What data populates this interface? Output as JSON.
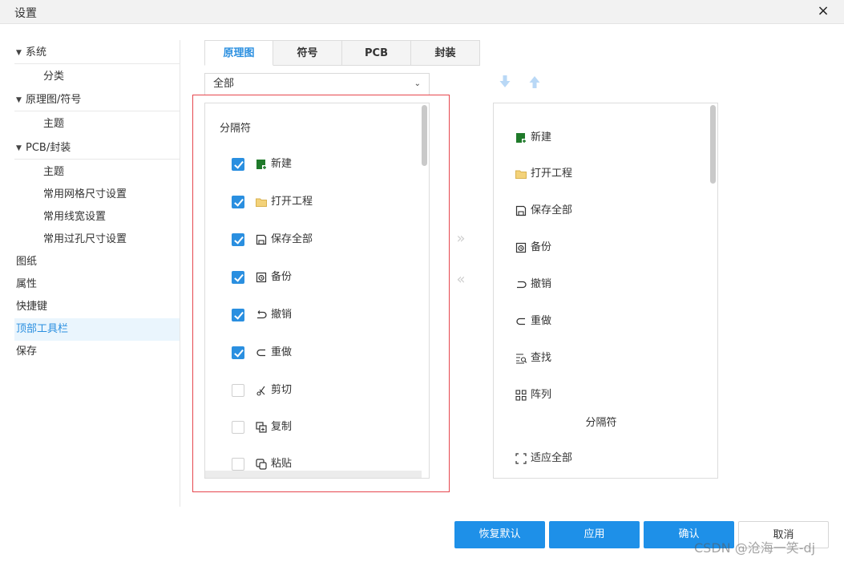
{
  "window": {
    "title": "设置",
    "close_glyph": "×"
  },
  "sidebar": {
    "groups": [
      {
        "label": "系统",
        "children": [
          "分类"
        ]
      },
      {
        "label": "原理图/符号",
        "children": [
          "主题"
        ]
      },
      {
        "label": "PCB/封装",
        "children": [
          "主题",
          "常用网格尺寸设置",
          "常用线宽设置",
          "常用过孔尺寸设置"
        ]
      }
    ],
    "items": [
      "图纸",
      "属性",
      "快捷键",
      "顶部工具栏",
      "保存"
    ],
    "active_item": "顶部工具栏"
  },
  "tabs": [
    {
      "label": "原理图",
      "active": true
    },
    {
      "label": "符号",
      "active": false
    },
    {
      "label": "PCB",
      "active": false
    },
    {
      "label": "封装",
      "active": false
    }
  ],
  "filter": {
    "value": "全部"
  },
  "available": {
    "separator_label": "分隔符",
    "items": [
      {
        "label": "新建",
        "checked": true,
        "icon": "new-file-icon"
      },
      {
        "label": "打开工程",
        "checked": true,
        "icon": "folder-icon"
      },
      {
        "label": "保存全部",
        "checked": true,
        "icon": "save-icon"
      },
      {
        "label": "备份",
        "checked": true,
        "icon": "backup-icon"
      },
      {
        "label": "撤销",
        "checked": true,
        "icon": "undo-icon"
      },
      {
        "label": "重做",
        "checked": true,
        "icon": "redo-icon"
      },
      {
        "label": "剪切",
        "checked": false,
        "icon": "scissors-icon"
      },
      {
        "label": "复制",
        "checked": false,
        "icon": "copy-icon"
      },
      {
        "label": "粘贴",
        "checked": false,
        "icon": "paste-icon"
      }
    ]
  },
  "move_buttons": {
    "add": "»",
    "remove": "«"
  },
  "selected": {
    "items": [
      {
        "label": "新建",
        "icon": "new-file-icon"
      },
      {
        "label": "打开工程",
        "icon": "folder-icon"
      },
      {
        "label": "保存全部",
        "icon": "save-icon"
      },
      {
        "label": "备份",
        "icon": "backup-icon"
      },
      {
        "label": "撤销",
        "icon": "undo-icon"
      },
      {
        "label": "重做",
        "icon": "redo-icon"
      },
      {
        "label": "查找",
        "icon": "find-icon"
      },
      {
        "label": "阵列",
        "icon": "array-icon"
      },
      {
        "label": "分隔符",
        "icon": "",
        "separator": true
      },
      {
        "label": "适应全部",
        "icon": "fit-all-icon"
      }
    ]
  },
  "footer": {
    "restore_label": "恢复默认",
    "apply_label": "应用",
    "confirm_label": "确认",
    "cancel_label": "取消"
  },
  "watermark": "CSDN @沧海一笑-dj",
  "colors": {
    "accent": "#1e90e8",
    "active_text": "#2a8fe0",
    "highlight_box": "#e6474e",
    "new_icon": "#1f7a2a",
    "folder_icon": "#f3d27a"
  }
}
